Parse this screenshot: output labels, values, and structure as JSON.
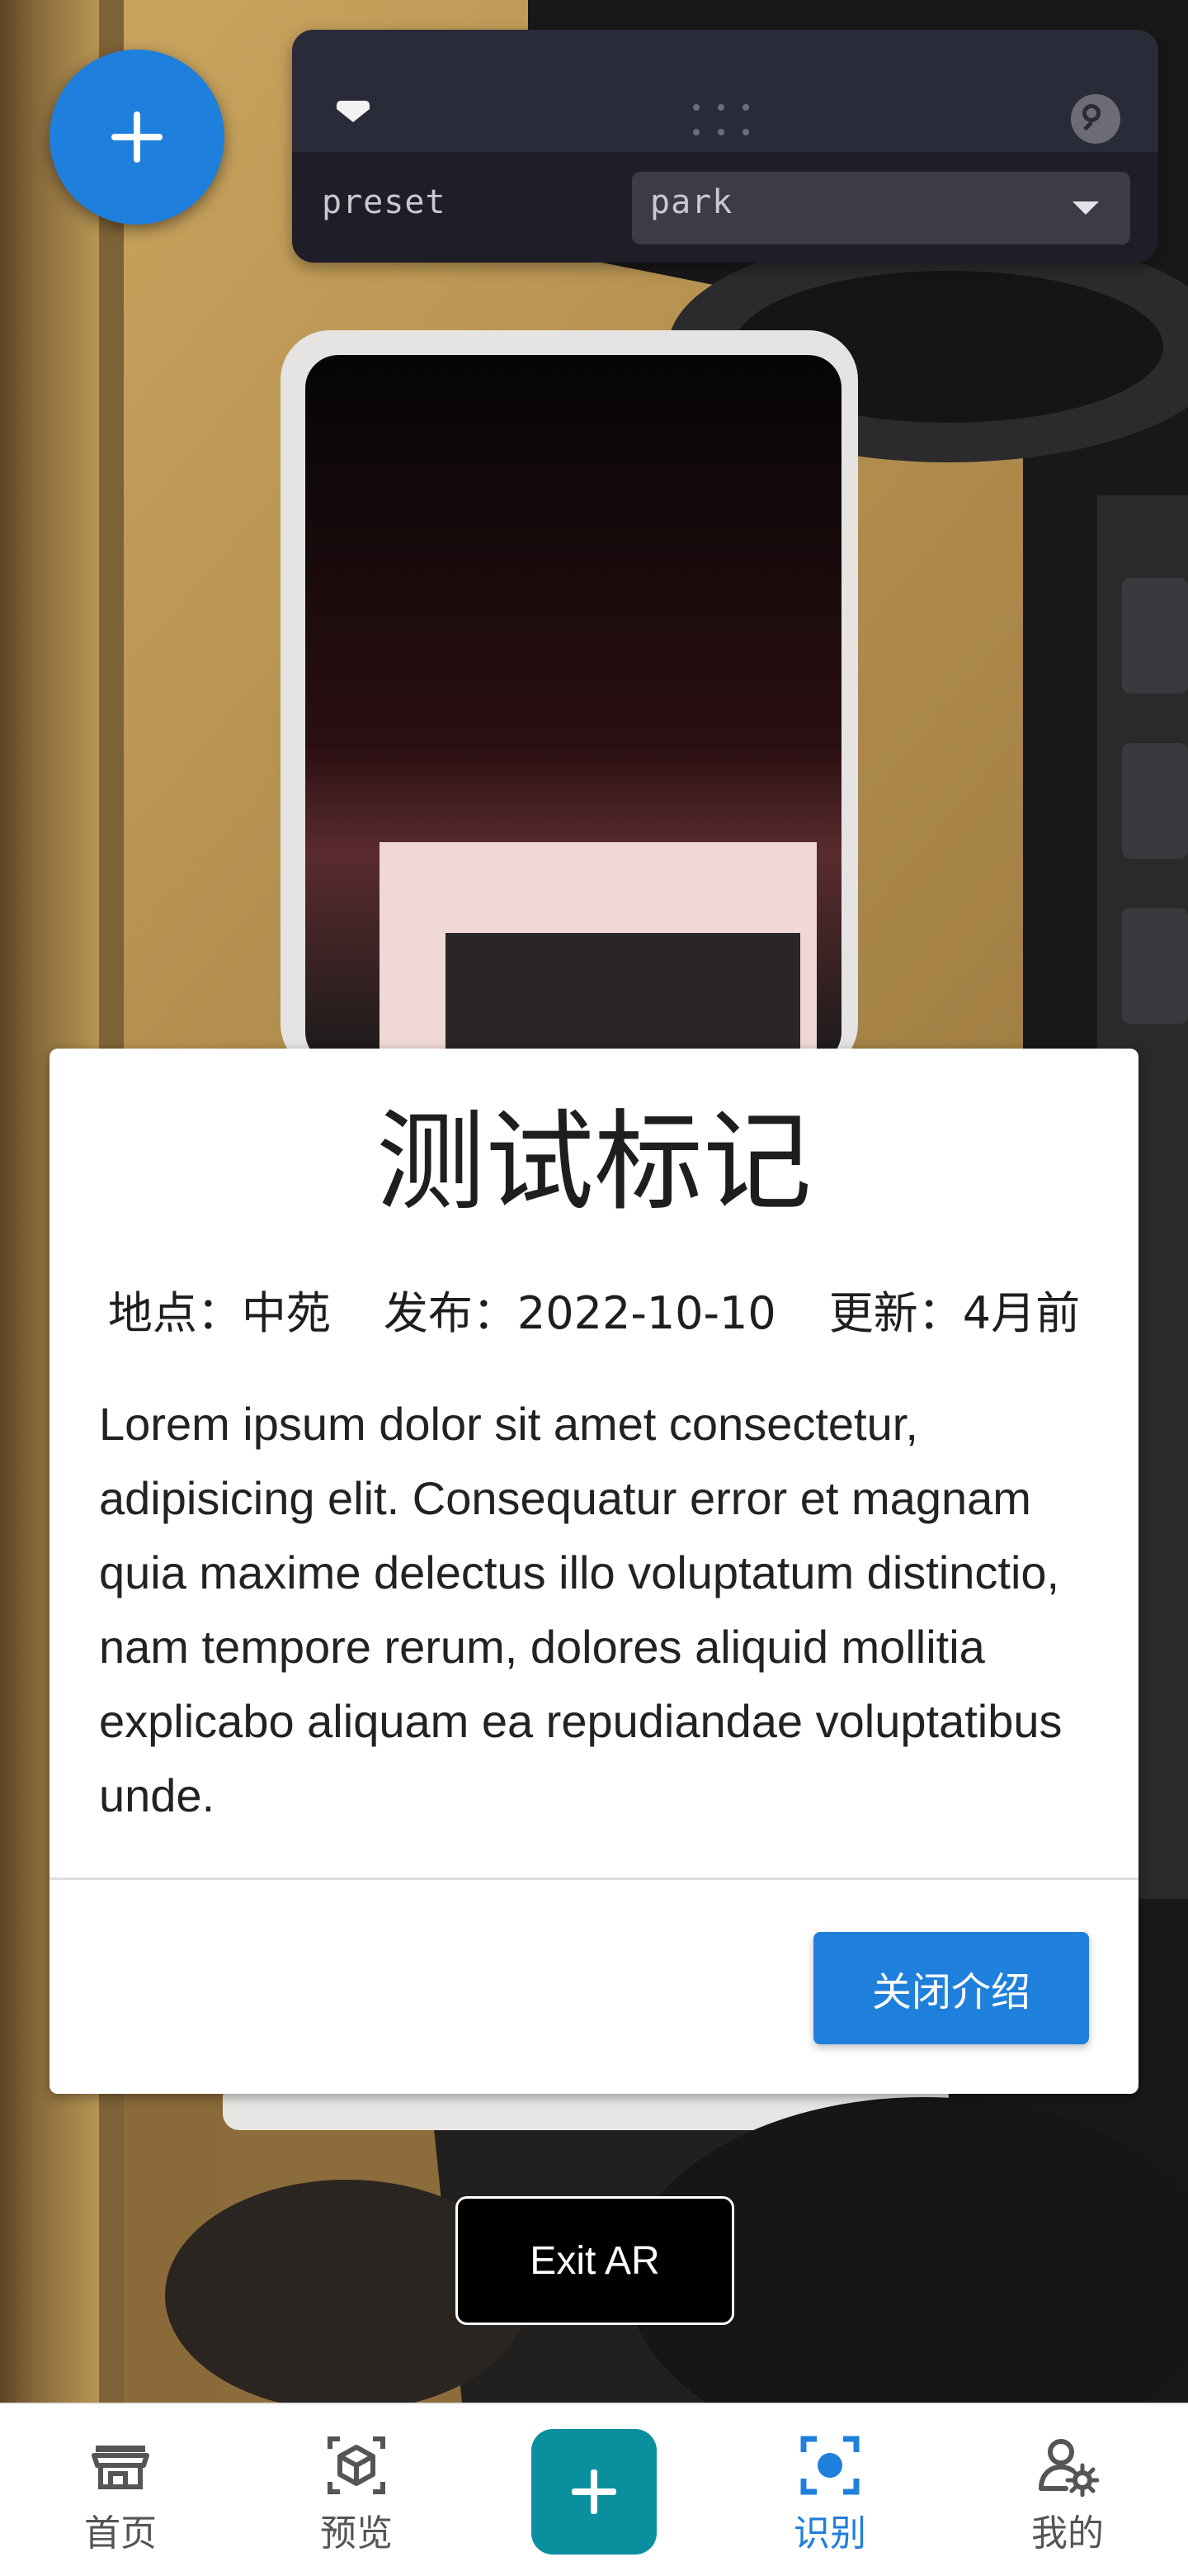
{
  "gui": {
    "preset_label": "preset",
    "preset_value": "park"
  },
  "card": {
    "title": "测试标记",
    "location": "地点：中苑",
    "published": "发布：2022-10-10",
    "updated": "更新：4月前",
    "body": "Lorem ipsum dolor sit amet consectetur, adipisicing elit. Consequatur error et magnam quia maxime delectus illo voluptatum distinctio, nam tempore rerum, dolores aliquid mollitia explicabo aliquam ea repudiandae voluptatibus unde.",
    "close_label": "关闭介绍"
  },
  "exit_ar_label": "Exit AR",
  "tabs": [
    {
      "label": "首页",
      "icon": "storefront-icon",
      "active": false
    },
    {
      "label": "预览",
      "icon": "cube-icon",
      "active": false
    },
    {
      "label": "",
      "icon": "plus-icon",
      "active": false
    },
    {
      "label": "识别",
      "icon": "scan-icon",
      "active": true
    },
    {
      "label": "我的",
      "icon": "user-settings-icon",
      "active": false
    }
  ],
  "colors": {
    "primary": "#1f7fdc",
    "center_tab": "#0a8f9f",
    "gui_panel": "#1d1e27",
    "gui_header": "#2a2b38"
  }
}
